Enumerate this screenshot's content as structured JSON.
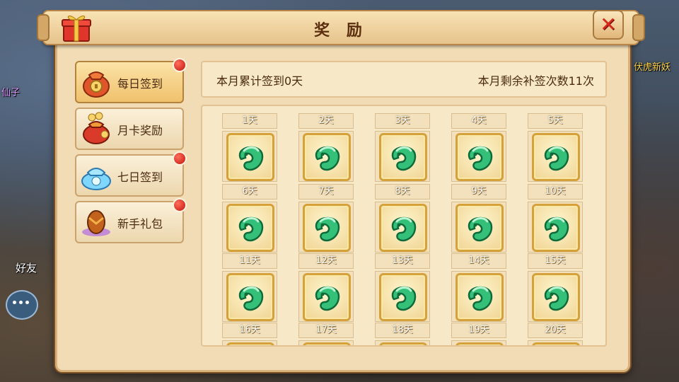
{
  "background": {
    "friend_label": "好友",
    "npc_name_left": "仙子",
    "npc_name_right": "伏虎新妖"
  },
  "dialog": {
    "title": "奖 励",
    "close_icon": "close-icon"
  },
  "tabs": [
    {
      "label": "每日签到",
      "icon": "coin-bag-icon",
      "badge": true,
      "active": true
    },
    {
      "label": "月卡奖励",
      "icon": "money-bag-icon",
      "badge": false,
      "active": false
    },
    {
      "label": "七日签到",
      "icon": "blue-bag-icon",
      "badge": true,
      "active": false
    },
    {
      "label": "新手礼包",
      "icon": "gift-egg-icon",
      "badge": true,
      "active": false
    }
  ],
  "info": {
    "signed_text": "本月累计签到0天",
    "remaining_text": "本月剩余补签次数11次"
  },
  "calendar": {
    "days": [
      "1天",
      "2天",
      "3天",
      "4天",
      "5天",
      "6天",
      "7天",
      "8天",
      "9天",
      "10天",
      "11天",
      "12天",
      "13天",
      "14天",
      "15天",
      "16天",
      "17天",
      "18天",
      "19天",
      "20天"
    ],
    "reward_icon": "jade-icon"
  },
  "colors": {
    "panel": "#f1dcb6",
    "accent": "#d4a13a",
    "badge": "#c3130a",
    "close": "#d8281c"
  }
}
